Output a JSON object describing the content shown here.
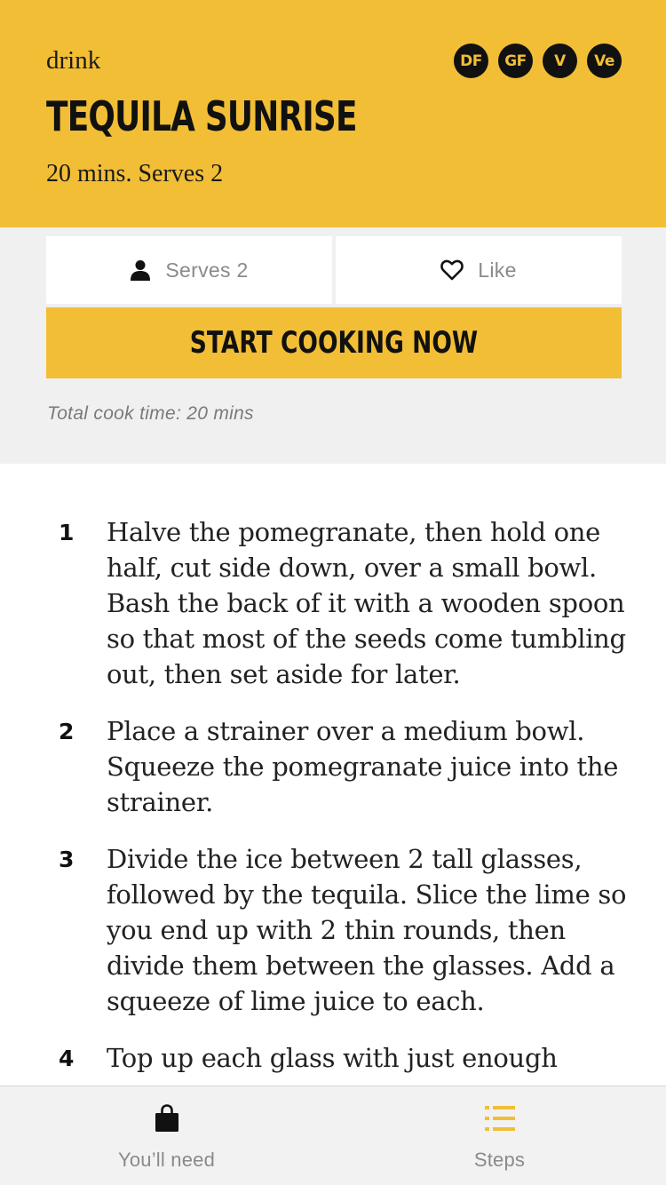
{
  "header": {
    "category": "drink",
    "title": "TEQUILA SUNRISE",
    "subtitle": "20 mins. Serves 2",
    "badges": [
      "DF",
      "GF",
      "V",
      "Ve"
    ]
  },
  "actions": {
    "serves_label": "Serves 2",
    "like_label": "Like",
    "start_label": "START COOKING NOW",
    "cook_time": "Total cook time: 20 mins"
  },
  "steps": [
    {
      "number": "1",
      "text": "Halve the pomegranate, then hold one half, cut side down, over a small bowl. Bash the back of it with a wooden spoon so that most of the seeds come tumbling out, then set aside for later."
    },
    {
      "number": "2",
      "text": "Place a strainer over a medium bowl. Squeeze the pomegranate juice into the strainer."
    },
    {
      "number": "3",
      "text": "Divide the ice between 2 tall glasses, followed by the tequila. Slice the lime so you end up with 2 thin rounds, then divide them between the glasses. Add a squeeze of lime juice to each."
    },
    {
      "number": "4",
      "text": "Top up each glass with just enough"
    }
  ],
  "tabbar": {
    "needs_label": "You’ll need",
    "steps_label": "Steps"
  },
  "colors": {
    "accent": "#f2be35",
    "badge_bg": "#111111",
    "muted_text": "#8a8a8a"
  },
  "icons": {
    "serves": "person-icon",
    "like": "heart-icon",
    "needs": "shopping-bag-icon",
    "steps": "list-icon"
  }
}
